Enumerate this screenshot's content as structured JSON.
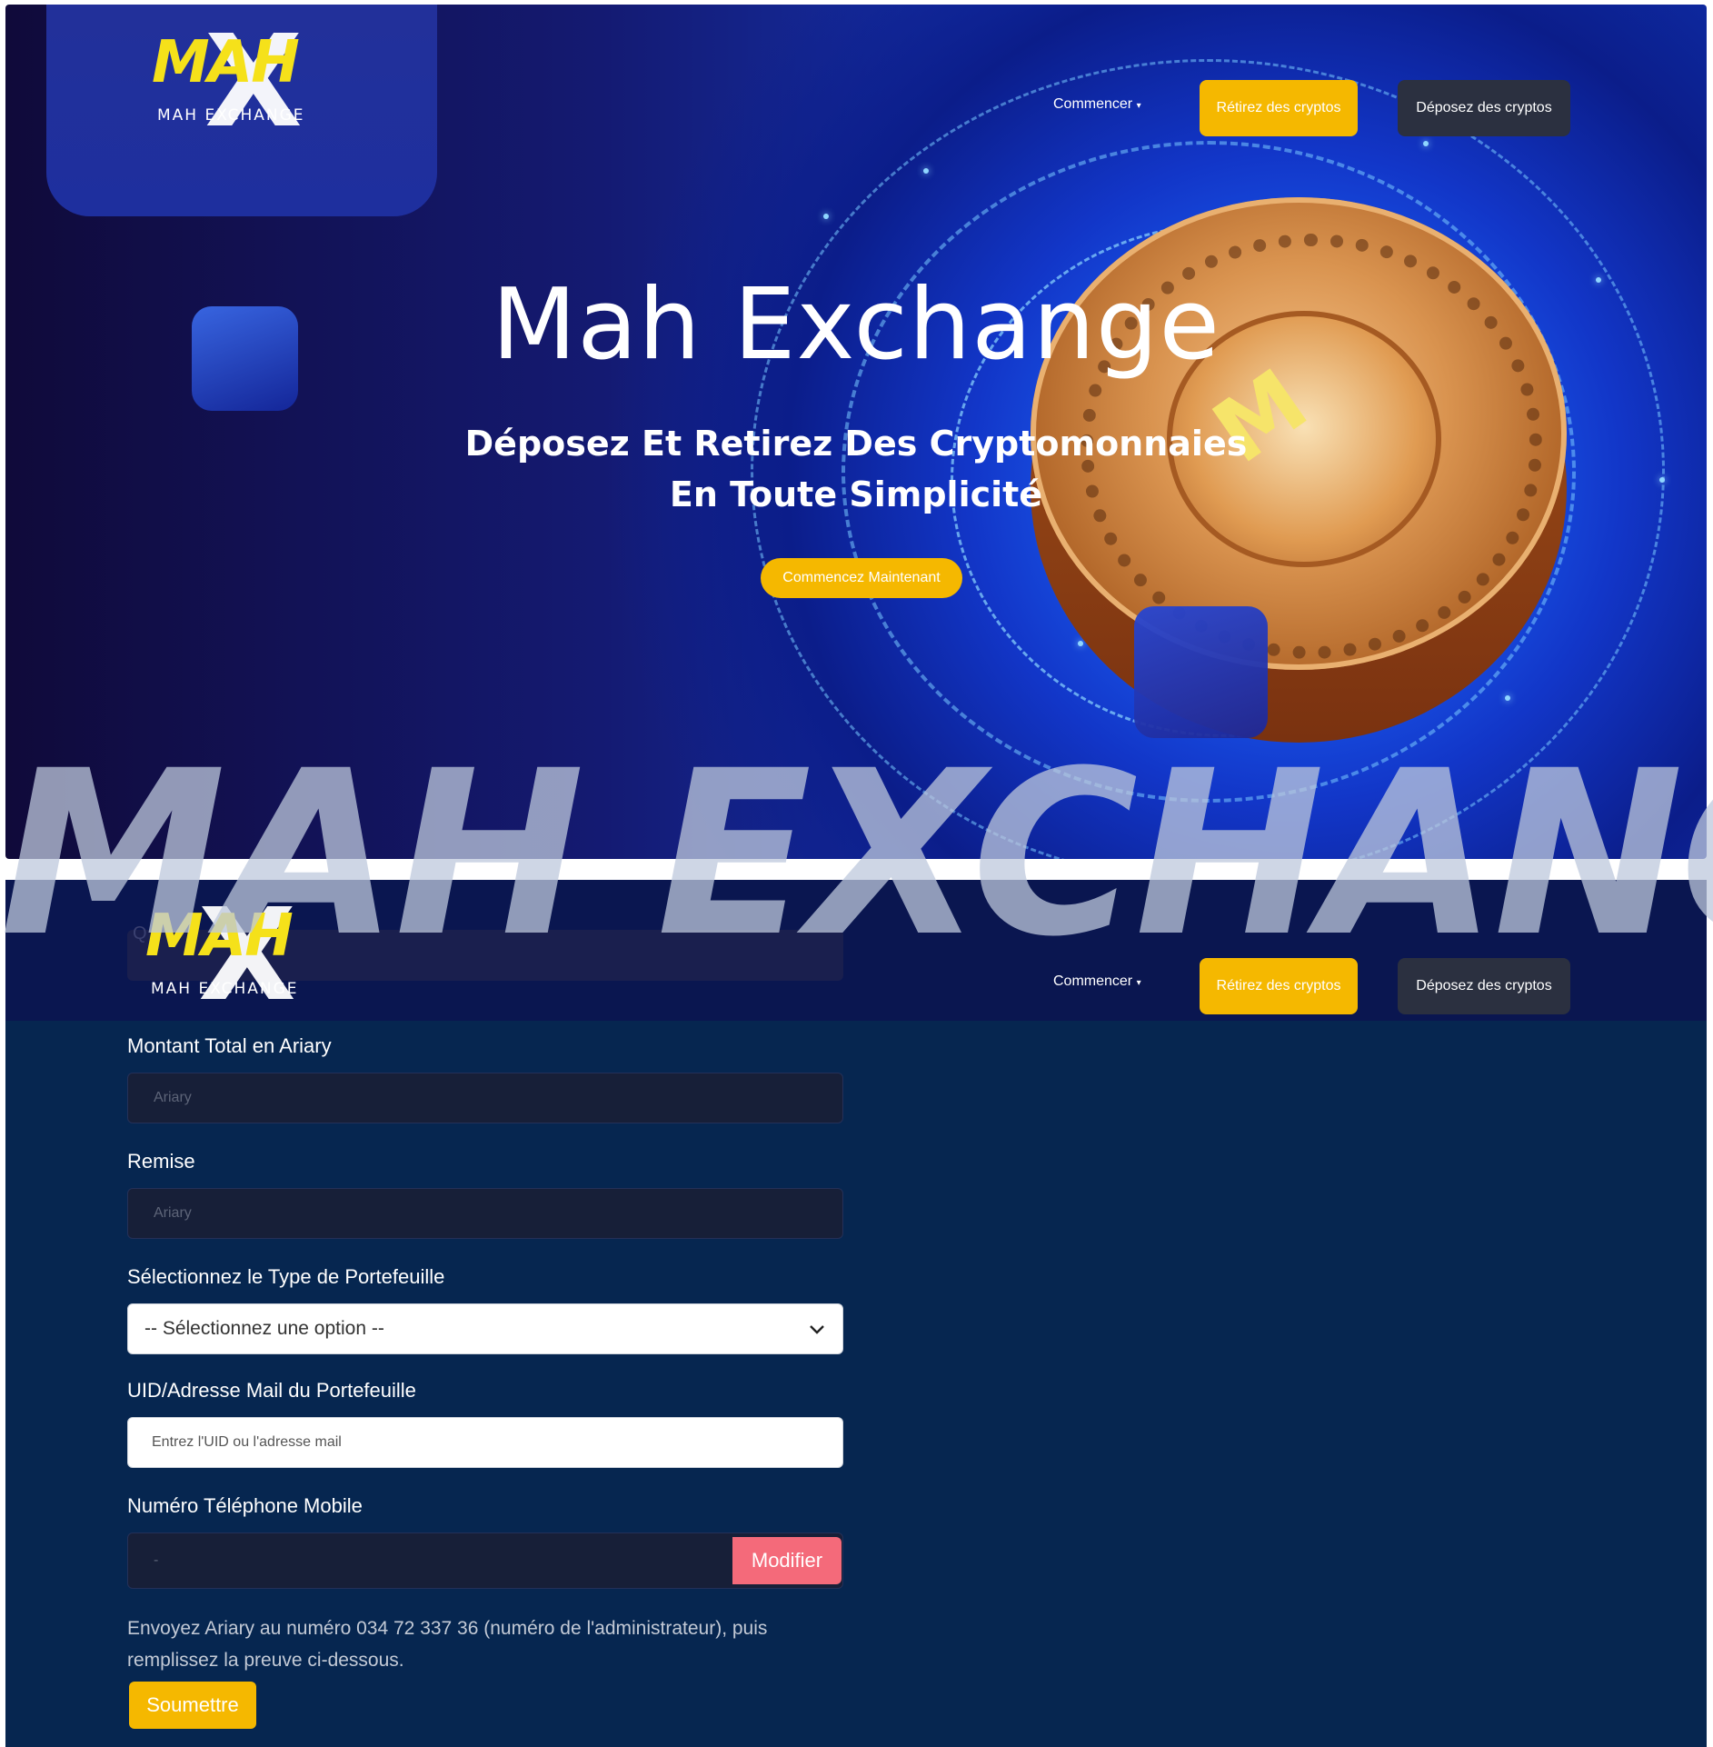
{
  "brand": {
    "logo_main": "MAH",
    "logo_sub": "MAH EXCHANGE",
    "watermark": "MAH EXCHANGE"
  },
  "nav": {
    "start_label": "Commencer",
    "withdraw_label": "Rétirez des cryptos",
    "deposit_label": "Déposez des cryptos"
  },
  "hero": {
    "title": "Mah Exchange",
    "subtitle_line1": "Déposez Et Retirez Des Cryptomonnaies",
    "subtitle_line2": "En Toute Simplicité",
    "cta_label": "Commencez Maintenant"
  },
  "form": {
    "hidden_label": "Q",
    "total_label": "Montant Total en Ariary",
    "total_placeholder": "Ariary",
    "discount_label": "Remise",
    "discount_placeholder": "Ariary",
    "wallet_type_label": "Sélectionnez le Type de Portefeuille",
    "wallet_type_value": "-- Sélectionnez une option --",
    "wallet_uid_label": "UID/Adresse Mail du Portefeuille",
    "wallet_uid_placeholder": "Entrez l'UID ou l'adresse mail",
    "phone_label": "Numéro Téléphone Mobile",
    "phone_value": "-",
    "modify_label": "Modifier",
    "note": "Envoyez Ariary au numéro 034 72 337 36 (numéro de l'administrateur), puis remplissez la preuve ci-dessous.",
    "submit_label": "Soumettre"
  },
  "colors": {
    "accent_yellow": "#f5b800",
    "dark_button": "#2b3040",
    "modify_pink": "#f46a7a",
    "form_background": "#062650"
  },
  "icons": [
    "caret-down-icon",
    "chevron-down-icon",
    "coin-logo"
  ]
}
